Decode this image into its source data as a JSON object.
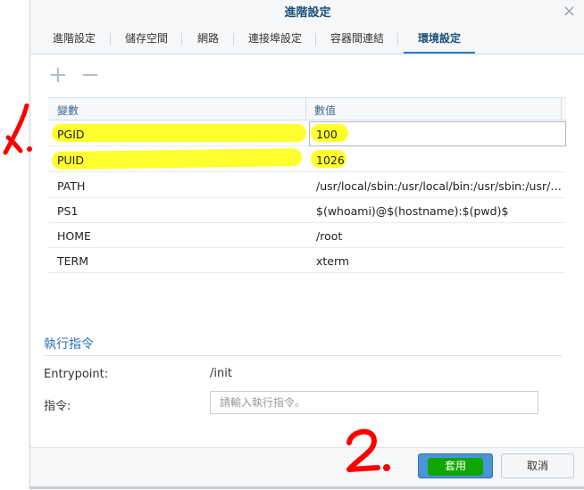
{
  "dialog": {
    "title": "進階設定",
    "close_label": "×"
  },
  "tabs": [
    {
      "label": "進階設定"
    },
    {
      "label": "儲存空間"
    },
    {
      "label": "網路"
    },
    {
      "label": "連接埠設定"
    },
    {
      "label": "容器間連結"
    },
    {
      "label": "環境設定",
      "active": true
    }
  ],
  "toolbar": {
    "add_label": "+",
    "remove_label": "−"
  },
  "env_table": {
    "headers": [
      "變數",
      "數值"
    ],
    "rows": [
      {
        "key": "PGID",
        "value": "100"
      },
      {
        "key": "PUID",
        "value": "1026"
      },
      {
        "key": "PATH",
        "value": "/usr/local/sbin:/usr/local/bin:/usr/sbin:/usr/bin:/sbin:/bin"
      },
      {
        "key": "PS1",
        "value": "$(whoami)@$(hostname):$(pwd)$"
      },
      {
        "key": "HOME",
        "value": "/root"
      },
      {
        "key": "TERM",
        "value": "xterm"
      }
    ]
  },
  "execution": {
    "section_title": "執行指令",
    "entrypoint_label": "Entrypoint:",
    "entrypoint_value": "/init",
    "command_label": "指令:",
    "command_placeholder": "請輸入執行指令。"
  },
  "footer": {
    "apply_label": "套用",
    "cancel_label": "取消"
  },
  "annotations": {
    "mark1": "1.",
    "mark2": "2."
  },
  "colors": {
    "highlight": "#ffff22",
    "apply_marker": "#0fa600",
    "annotation": "#ff0000",
    "accent": "#2d7ac6"
  }
}
